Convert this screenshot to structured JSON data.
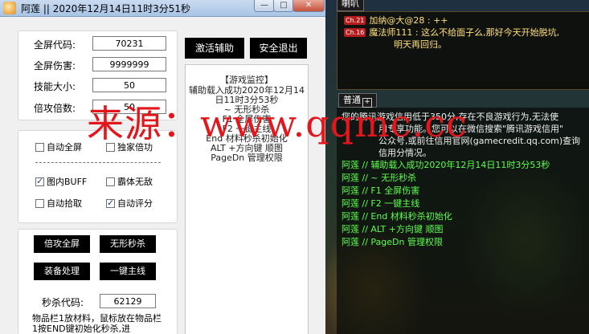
{
  "window": {
    "title": "阿莲 ||  2020年12月14日11时3分51秒",
    "min_glyph": "—",
    "max_glyph": "□",
    "close_glyph": "✕"
  },
  "settings": {
    "fullscreen_code_label": "全屏代码:",
    "fullscreen_code": "70231",
    "fullscreen_damage_label": "全屏伤害:",
    "fullscreen_damage": "9999999",
    "skill_size_label": "技能大小:",
    "skill_size": "50",
    "attack_multiplier_label": "倍攻倍数:",
    "attack_multiplier": "50"
  },
  "options": {
    "auto_fullscreen": {
      "label": "自动全屏",
      "checked": false
    },
    "exclusive_attack": {
      "label": "独家倍功",
      "checked": false
    },
    "map_buff": {
      "label": "图内BUFF",
      "checked": true
    },
    "invincible": {
      "label": "霸体无敌",
      "checked": false
    },
    "auto_pickup": {
      "label": "自动拾取",
      "checked": false
    },
    "auto_score": {
      "label": "自动评分",
      "checked": true
    }
  },
  "actions": {
    "attack_fullscreen": "倍攻全屏",
    "invisible_kill": "无形秒杀",
    "equip_process": "装备处理",
    "main_quest": "一键主线",
    "kill_code_label": "秒杀代码:",
    "kill_code": "62129",
    "hint": "物品栏1放材料，鼠标放在物品栏1按END键初始化秒杀,进"
  },
  "top_buttons": {
    "activate": "激活辅助",
    "exit": "安全退出"
  },
  "monitor": {
    "title": "【游戏监控】",
    "lines": [
      "辅助载入成功2020年12月14",
      "日11时3分53秒",
      "~ 无形秒杀",
      "F1 全屏伤害",
      "F2 一键主线",
      "End 材料秒杀初始化",
      "ALT +方向键 顺图",
      "PageDn 管理权限"
    ]
  },
  "watermark": "来源：www.qqmc.cc",
  "game": {
    "top_tab": "喇叭",
    "chat_top": [
      {
        "level": "Ch.21",
        "text": "加纳@大@28 : ++",
        "color": "#ffe07a"
      },
      {
        "level": "Ch.16",
        "text": "魔法师111 : 这么不给面子么,那好今天开始脱坑,",
        "color": "#ffe07a"
      },
      {
        "level": "",
        "text": "明天再回归。",
        "color": "#ffe07a"
      }
    ],
    "main_tab": "普通",
    "expand_glyph": "+",
    "system_lines": [
      "您的腾讯游戏信用低于350分,存在不良游戏行为,无法使",
      "用专享功能。您可以在微信搜索\"腾讯游戏信用\"",
      "公众号,或前往信用官网(gamecredit.qq.com)查询",
      "信用分情况。"
    ],
    "green_lines": [
      "阿莲 //  辅助载入成功2020年12月14日11时3分53秒",
      "阿莲 //  ~ 无形秒杀",
      "阿莲 //  F1 全屏伤害",
      "阿莲 //  F2 一键主线",
      "阿莲 //  End 材料秒杀初始化",
      "阿莲 //  ALT +方向键 顺图",
      "阿莲 //  PageDn 管理权限"
    ]
  }
}
